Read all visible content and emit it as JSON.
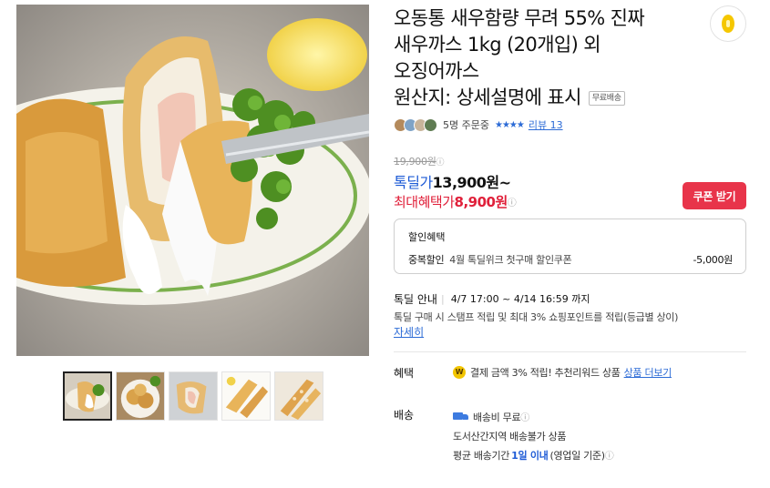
{
  "product": {
    "title_line1": "오동통 새우함량 무려 55% 진짜",
    "title_line2": "새우까스 1kg (20개입) 외",
    "title_line3": "오징어까스",
    "title_line4": "원산지: 상세설명에 표시",
    "free_shipping_badge": "무료배송"
  },
  "share_icon": "coin-icon",
  "reviews": {
    "orders_text": "5명 주문중",
    "stars": "★★★★",
    "review_link": "리뷰 13"
  },
  "price": {
    "original": "19,900원",
    "info_glyph": "ⓘ",
    "deal_label": "톡딜가",
    "deal_price": "13,900원~",
    "max_label": "최대혜택가",
    "max_price": "8,900원",
    "coupon_button": "쿠폰 받기"
  },
  "discount": {
    "heading": "할인혜택",
    "row_label": "중복할인",
    "row_desc": "4월 톡딜위크 첫구매 할인쿠폰",
    "row_value": "-5,000원"
  },
  "deal_period": {
    "label": "톡딜 안내",
    "period": "4/7 17:00 ~ 4/14 16:59 까지",
    "desc": "톡딜 구매 시 스탬프 적립 및 최대 3% 쇼핑포인트를 적립(등급별 상이)",
    "more_link": "자세히"
  },
  "benefit": {
    "label": "혜택",
    "icon_text": "W",
    "text": "결제 금액 3% 적립! 추천리워드 상품",
    "link": "상품 더보기"
  },
  "shipping": {
    "label": "배송",
    "fee": "배송비 무료",
    "restriction": "도서산간지역 배송불가 상품",
    "avg_prefix": "평균 배송기간",
    "avg_value": "1일 이내",
    "avg_suffix": "(영업일 기준)"
  },
  "colors": {
    "accent_blue": "#1e5bd6",
    "accent_red": "#e0203a",
    "coupon_red": "#e8344a"
  }
}
